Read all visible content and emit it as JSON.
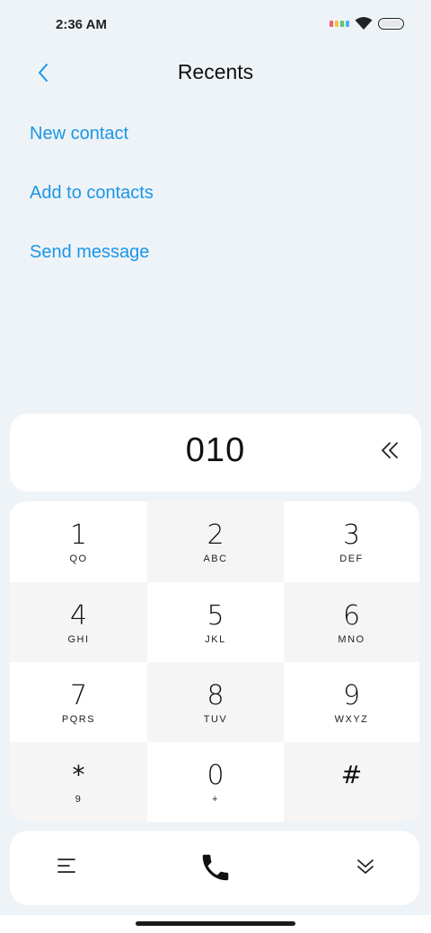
{
  "status": {
    "time": "2:36 AM",
    "signal_colors": [
      "#f4606c",
      "#f8c04e",
      "#56c96f",
      "#4fb2f1"
    ],
    "icons": [
      "wifi-icon",
      "battery-icon"
    ]
  },
  "header": {
    "title": "Recents",
    "back_icon": "chevron-left-icon"
  },
  "actions": [
    {
      "label": "New contact"
    },
    {
      "label": "Add to contacts"
    },
    {
      "label": "Send message"
    }
  ],
  "dialer": {
    "number": "010",
    "backspace_icon": "double-chevron-left-icon"
  },
  "keypad": {
    "keys": [
      {
        "digit": "1",
        "letters": "QO"
      },
      {
        "digit": "2",
        "letters": "ABC"
      },
      {
        "digit": "3",
        "letters": "DEF"
      },
      {
        "digit": "4",
        "letters": "GHI"
      },
      {
        "digit": "5",
        "letters": "JKL"
      },
      {
        "digit": "6",
        "letters": "MNO"
      },
      {
        "digit": "7",
        "letters": "PQRS"
      },
      {
        "digit": "8",
        "letters": "TUV"
      },
      {
        "digit": "9",
        "letters": "WXYZ"
      },
      {
        "digit": "*",
        "letters": "9"
      },
      {
        "digit": "0",
        "letters": "+"
      },
      {
        "digit": "#",
        "letters": ""
      }
    ]
  },
  "bottom": {
    "menu_icon": "menu-icon",
    "call_icon": "phone-icon",
    "collapse_icon": "double-chevron-down-icon"
  },
  "colors": {
    "accent": "#1a96e8",
    "background": "#eef3f7"
  }
}
